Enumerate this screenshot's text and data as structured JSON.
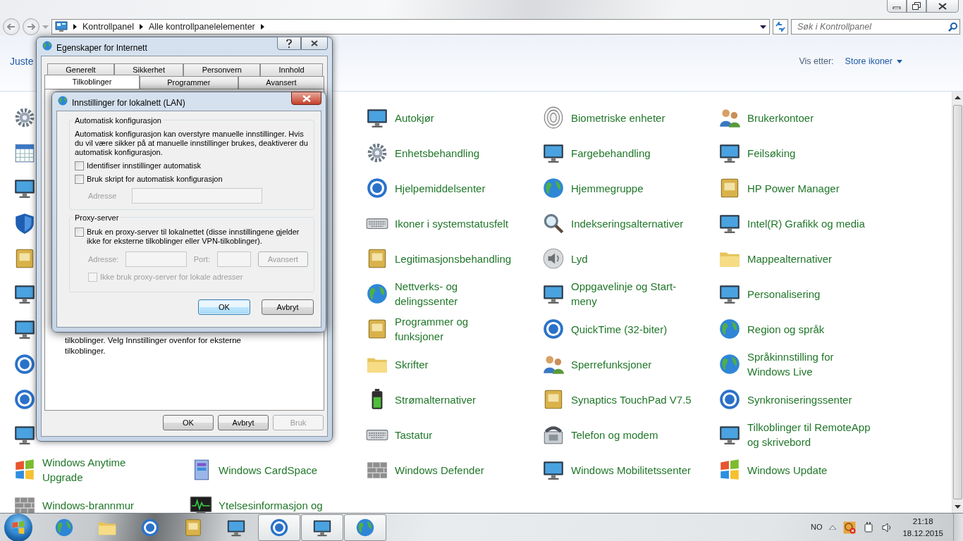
{
  "address_bar": {
    "breadcrumbs": [
      "Kontrollpanel",
      "Alle kontrollpanelelementer"
    ],
    "search_placeholder": "Søk i Kontrollpanel"
  },
  "header": {
    "title": "Juste",
    "view_label": "Vis etter:",
    "view_value": "Store ikoner"
  },
  "items": [
    {
      "kind": "icon_only"
    },
    {
      "kind": "hidden"
    },
    {
      "kind": "item",
      "label": "Autokjør"
    },
    {
      "kind": "item",
      "label": "Biometriske enheter"
    },
    {
      "kind": "item",
      "label": "Brukerkontoer"
    },
    {
      "kind": "icon_only"
    },
    {
      "kind": "hidden"
    },
    {
      "kind": "item",
      "label": "Enhetsbehandling"
    },
    {
      "kind": "item",
      "label": "Fargebehandling"
    },
    {
      "kind": "item",
      "label": "Feilsøking"
    },
    {
      "kind": "icon_only"
    },
    {
      "kind": "hidden"
    },
    {
      "kind": "item",
      "label": "Hjelpemiddelsenter"
    },
    {
      "kind": "item",
      "label": "Hjemmegruppe"
    },
    {
      "kind": "item",
      "label": "HP Power Manager"
    },
    {
      "kind": "icon_only"
    },
    {
      "kind": "hidden"
    },
    {
      "kind": "item",
      "label": "Ikoner i systemstatusfelt"
    },
    {
      "kind": "item",
      "label": "Indekseringsalternativer"
    },
    {
      "kind": "item",
      "label": "Intel(R) Grafikk og media"
    },
    {
      "kind": "icon_only"
    },
    {
      "kind": "hidden"
    },
    {
      "kind": "item",
      "label": "Legitimasjonsbehandling"
    },
    {
      "kind": "item",
      "label": "Lyd"
    },
    {
      "kind": "item",
      "label": "Mappealternativer"
    },
    {
      "kind": "icon_only"
    },
    {
      "kind": "hidden"
    },
    {
      "kind": "item",
      "label": "Nettverks- og delingssenter"
    },
    {
      "kind": "item",
      "label": "Oppgavelinje og Start-meny"
    },
    {
      "kind": "item",
      "label": "Personalisering"
    },
    {
      "kind": "icon_only"
    },
    {
      "kind": "hidden"
    },
    {
      "kind": "item",
      "label": "Programmer og funksjoner"
    },
    {
      "kind": "item",
      "label": "QuickTime (32-biter)"
    },
    {
      "kind": "item",
      "label": "Region og språk"
    },
    {
      "kind": "icon_only"
    },
    {
      "kind": "hidden"
    },
    {
      "kind": "item",
      "label": "Skrifter"
    },
    {
      "kind": "item",
      "label": "Sperrefunksjoner"
    },
    {
      "kind": "item",
      "label": "Språkinnstilling for Windows Live"
    },
    {
      "kind": "icon_only"
    },
    {
      "kind": "hidden"
    },
    {
      "kind": "item",
      "label": "Strømalternativer"
    },
    {
      "kind": "item",
      "label": "Synaptics TouchPad V7.5"
    },
    {
      "kind": "item",
      "label": "Synkroniseringssenter"
    },
    {
      "kind": "icon_only"
    },
    {
      "kind": "hidden"
    },
    {
      "kind": "item",
      "label": "Tastatur"
    },
    {
      "kind": "item",
      "label": "Telefon og modem"
    },
    {
      "kind": "item",
      "label": "Tilkoblinger til RemoteApp og skrivebord"
    },
    {
      "kind": "item",
      "label": "Windows Anytime Upgrade"
    },
    {
      "kind": "item",
      "label": "Windows CardSpace"
    },
    {
      "kind": "item",
      "label": "Windows Defender"
    },
    {
      "kind": "item",
      "label": "Windows Mobilitetssenter"
    },
    {
      "kind": "item",
      "label": "Windows Update"
    },
    {
      "kind": "item",
      "label": "Windows-brannmur"
    },
    {
      "kind": "item",
      "label": "Ytelsesinformasjon og"
    }
  ],
  "internet_options": {
    "title": "Egenskaper for Internett",
    "tab_rows": [
      [
        {
          "label": "Generelt",
          "selected": false
        },
        {
          "label": "Sikkerhet",
          "selected": false
        },
        {
          "label": "Personvern",
          "selected": false
        },
        {
          "label": "Innhold",
          "selected": false
        }
      ],
      [
        {
          "label": "Tilkoblinger",
          "selected": true
        },
        {
          "label": "Programmer",
          "selected": false
        },
        {
          "label": "Avansert",
          "selected": false
        }
      ]
    ],
    "note": "tilkoblinger. Velg Innstillinger ovenfor for eksterne tilkoblinger.",
    "buttons": [
      {
        "label": "OK",
        "disabled": false
      },
      {
        "label": "Avbryt",
        "disabled": false
      },
      {
        "label": "Bruk",
        "disabled": true
      }
    ]
  },
  "lan_dialog": {
    "title": "Innstillinger for lokalnett (LAN)",
    "auto_group": {
      "legend": "Automatisk konfigurasjon",
      "description": "Automatisk konfigurasjon kan overstyre manuelle innstillinger. Hvis du vil være sikker på at manuelle innstillinger brukes, deaktiverer du automatisk konfigurasjon.",
      "checkboxes": [
        {
          "label": "Identifiser innstillinger automatisk",
          "checked": false,
          "disabled": false
        },
        {
          "label": "Bruk skript for automatisk konfigurasjon",
          "checked": false,
          "disabled": false
        }
      ],
      "address": {
        "label": "Adresse",
        "disabled": true
      }
    },
    "proxy_group": {
      "legend": "Proxy-server",
      "checkbox": {
        "label": "Bruk en proxy-server til lokalnettet (disse innstillingene gjelder ikke for eksterne tilkoblinger eller VPN-tilkoblinger).",
        "checked": false,
        "disabled": false
      },
      "address": {
        "label": "Adresse:",
        "disabled": true
      },
      "port": {
        "label": "Port:",
        "disabled": true
      },
      "advanced": {
        "label": "Avansert",
        "disabled": true
      },
      "bypass": {
        "label": "Ikke bruk proxy-server for lokale adresser",
        "checked": false,
        "disabled": true
      }
    },
    "buttons": [
      {
        "label": "OK",
        "default": true
      },
      {
        "label": "Avbryt",
        "default": false
      }
    ]
  },
  "taskbar": {
    "apps": [
      {
        "open": false
      },
      {
        "open": false
      },
      {
        "open": false
      },
      {
        "open": false
      },
      {
        "open": false
      },
      {
        "open": true
      },
      {
        "open": true
      },
      {
        "open": true
      }
    ],
    "language": "NO",
    "time": "21:18",
    "date": "18.12.2015"
  }
}
